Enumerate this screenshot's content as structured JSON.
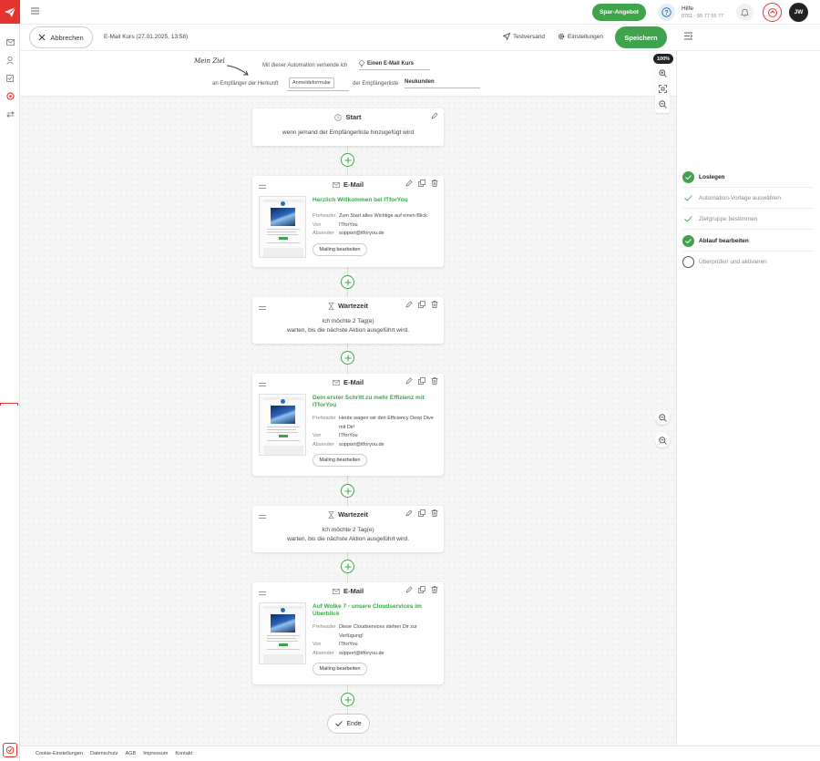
{
  "colors": {
    "brand": "#e5342d",
    "accent": "#3fa34d",
    "dark": "#222222"
  },
  "header": {
    "spar_label": "Spar-Angebot",
    "help_title": "Hilfe",
    "help_phone": "0761 - 55 77 55 77",
    "user_initials": "JW"
  },
  "actionbar": {
    "cancel_label": "Abbrechen",
    "title": "E-Mail Kurs (27.01.2025, 13:58)",
    "test_label": "Testversand",
    "settings_label": "Einstellungen",
    "save_label": "Speichern"
  },
  "goal": {
    "note": "Mein Ziel",
    "sentence1": "Mit dieser Automation versende ich",
    "value1": "Einen E-Mail Kurs",
    "sentence2": "an Empfänger der Herkunft",
    "chip": "Anmeldeformular",
    "sentence3": "der Empfängerliste",
    "value2": "Neukunden"
  },
  "zoom": {
    "level": "100%"
  },
  "flow": {
    "start": {
      "title": "Start",
      "text": "wenn jemand der Empfängerliste hinzugefügt wird"
    },
    "emails": [
      {
        "title": "E-Mail",
        "subject": "Herzlich Willkommen bei ITforYou",
        "preheader_label": "Preheader",
        "preheader": "Zum Start alles Wichtige auf einen Blick",
        "from_label": "Von",
        "from": "ITforYou",
        "sender_label": "Absender",
        "sender": "support@itforyou.de",
        "edit_label": "Mailing bearbeiten"
      },
      {
        "title": "E-Mail",
        "subject": "Dein erster Schritt zu mehr Effizienz mit ITforYou",
        "preheader_label": "Preheader",
        "preheader": "Heute wagen wir den Efficiency Deep Dive mit Dir!",
        "from_label": "Von",
        "from": "ITforYou",
        "sender_label": "Absender",
        "sender": "support@itforyou.de",
        "edit_label": "Mailing bearbeiten"
      },
      {
        "title": "E-Mail",
        "subject": "Auf Wolke 7 - unsere Cloudservices im Überblick",
        "preheader_label": "Preheader",
        "preheader": "Diese Cloudservices stehen Dir zur Verfügung!",
        "from_label": "Von",
        "from": "ITforYou",
        "sender_label": "Absender",
        "sender": "support@itforyou.de",
        "edit_label": "Mailing bearbeiten"
      }
    ],
    "waits": [
      {
        "title": "Wartezeit",
        "line1": "Ich möchte 2 Tag(e)",
        "line2": "warten, bis die nächste Aktion ausgeführt wird."
      },
      {
        "title": "Wartezeit",
        "line1": "Ich möchte 2 Tag(e)",
        "line2": "warten, bis die nächste Aktion ausgeführt wird."
      }
    ],
    "end_label": "Ende"
  },
  "steps": [
    {
      "label": "Loslegen",
      "state": "done-filled"
    },
    {
      "label": "Automation-Vorlage auswählen",
      "state": "done"
    },
    {
      "label": "Zielgruppe bestimmen",
      "state": "done"
    },
    {
      "label": "Ablauf bearbeiten",
      "state": "current"
    },
    {
      "label": "Überprüfen und aktivieren",
      "state": "open"
    }
  ],
  "footer": {
    "links": [
      "Cookie-Einstellungen",
      "Datenschutz",
      "AGB",
      "Impressum",
      "Kontakt"
    ]
  }
}
